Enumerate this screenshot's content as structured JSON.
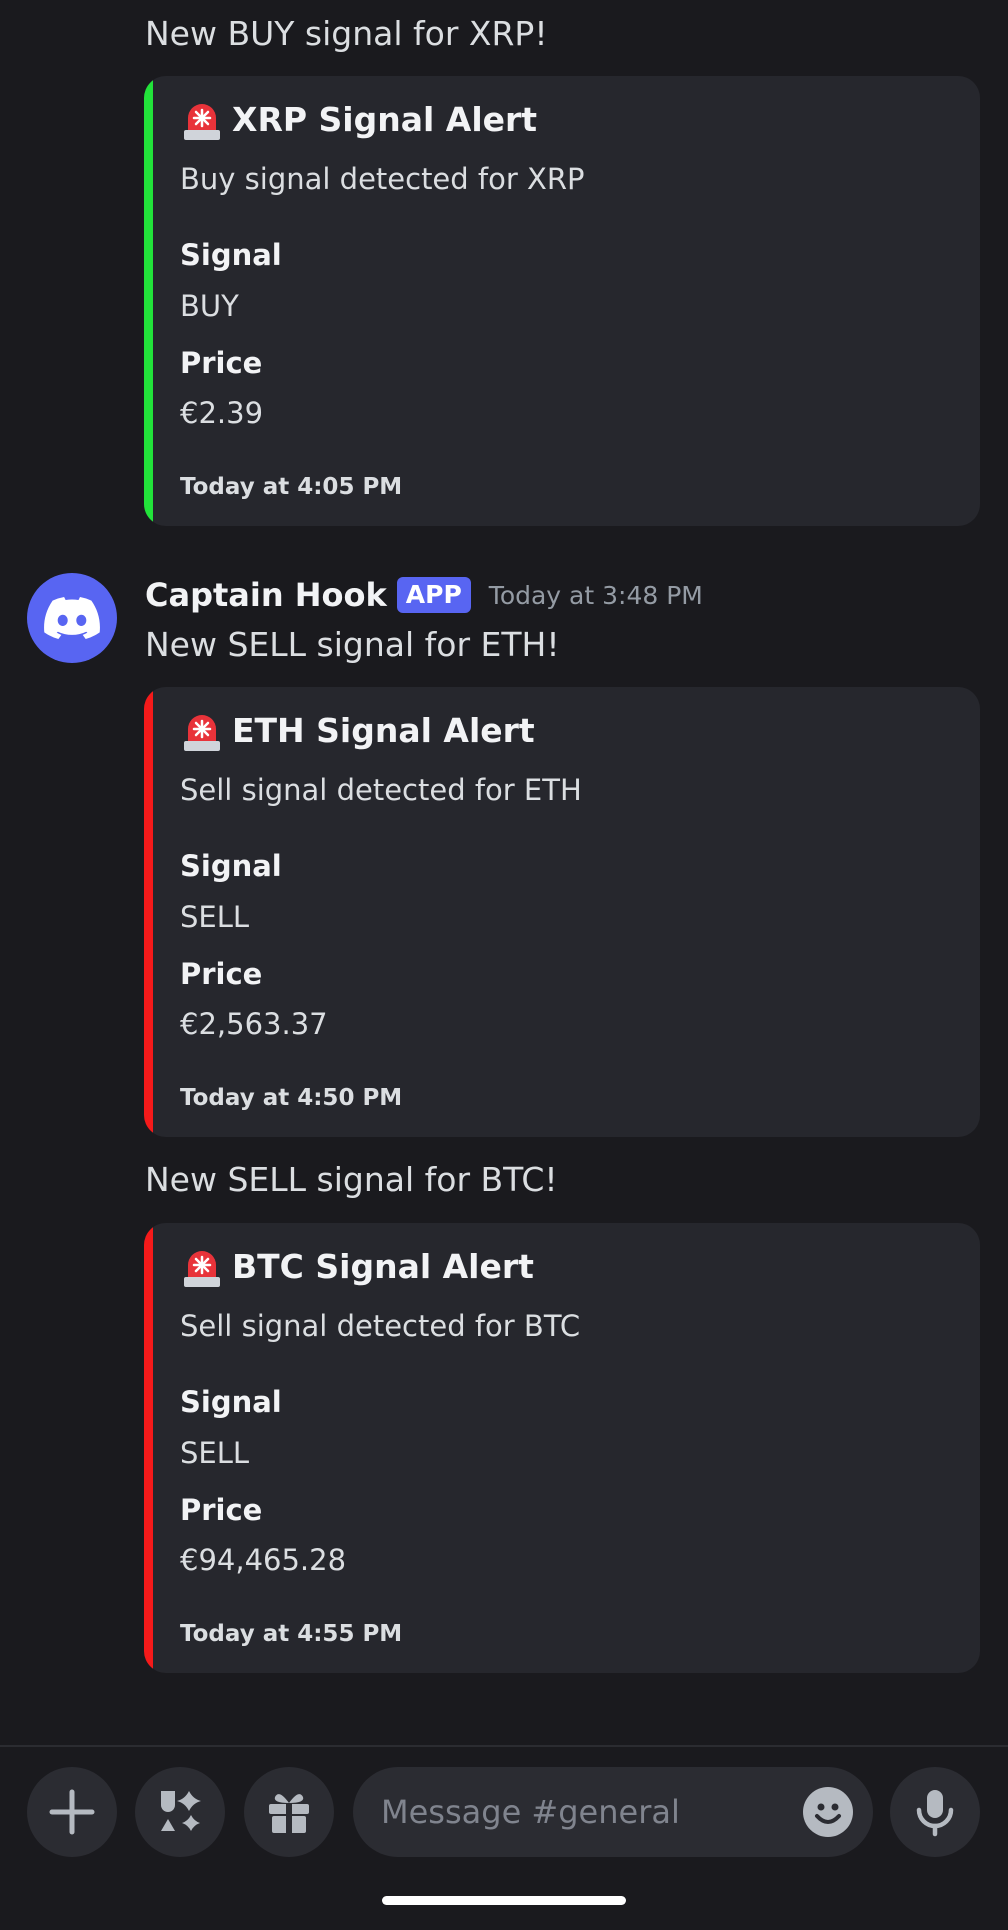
{
  "messages": [
    {
      "text": "New BUY signal for XRP!",
      "embed": {
        "bar_color": "#22e33a",
        "title": "XRP Signal Alert",
        "description": "Buy signal detected for XRP",
        "field1_name": "Signal",
        "field1_value": "BUY",
        "field2_name": "Price",
        "field2_value": "€2.39",
        "footer": "Today at 4:05 PM"
      }
    },
    {
      "author": "Captain Hook",
      "badge": "APP",
      "timestamp": "Today at 3:48 PM",
      "text": "New SELL signal for ETH!",
      "embed": {
        "bar_color": "#f51a1a",
        "title": "ETH Signal Alert",
        "description": "Sell signal detected for ETH",
        "field1_name": "Signal",
        "field1_value": "SELL",
        "field2_name": "Price",
        "field2_value": "€2,563.37",
        "footer": "Today at 4:50 PM"
      }
    },
    {
      "text": "New SELL signal for BTC!",
      "embed": {
        "bar_color": "#f51a1a",
        "title": "BTC Signal Alert",
        "description": "Sell signal detected for BTC",
        "field1_name": "Signal",
        "field1_value": "SELL",
        "field2_name": "Price",
        "field2_value": "€94,465.28",
        "footer": "Today at 4:55 PM"
      }
    }
  ],
  "composer": {
    "placeholder": "Message #general",
    "icons": [
      "plus-icon",
      "apps-icon",
      "gift-icon",
      "emoji-icon",
      "microphone-icon"
    ]
  },
  "colors": {
    "accent": "#5865f2",
    "background": "#1a1a1e",
    "embed_background": "#26272d"
  }
}
